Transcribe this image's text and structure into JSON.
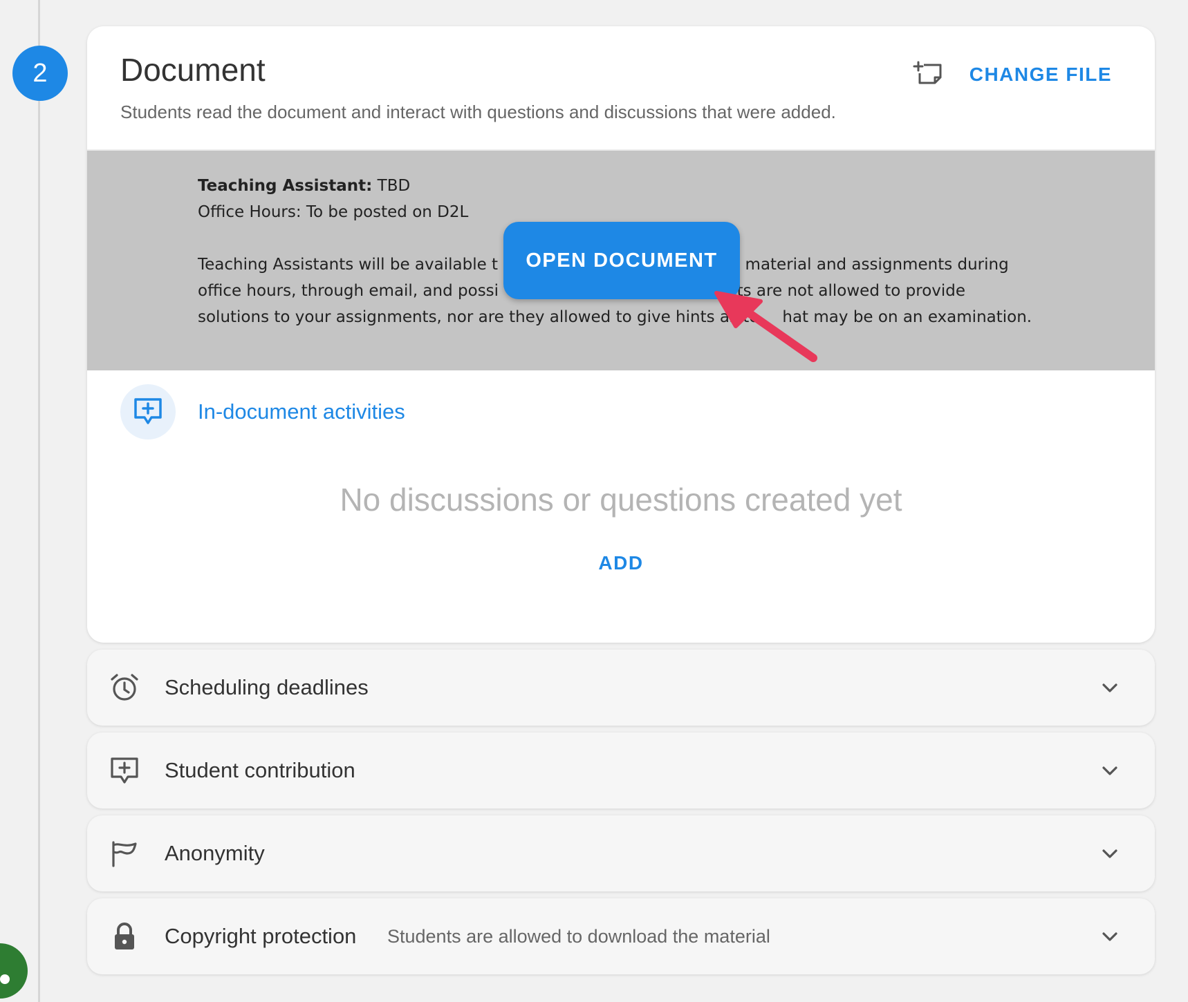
{
  "step": {
    "number": "2"
  },
  "card": {
    "title": "Document",
    "description": "Students read the document and interact with questions and discussions that were added.",
    "change_file_label": "CHANGE FILE",
    "open_document_label": "OPEN DOCUMENT",
    "preview": {
      "line1_bold": "Teaching Assistant:",
      "line1_rest": " TBD",
      "line2": "Office Hours: To be posted on D2L",
      "para1_a": "Teaching Assistants will be available t",
      "para1_b": "urse material and assignments during",
      "para2_a": "office hours, through email, and possi",
      "para2_b": "nts are not allowed to provide",
      "para3_a": "solutions to your assignments, nor are they allowed to give hints as to",
      "para3_b": "hat may be on an examination."
    },
    "activities_label": "In-document activities",
    "empty_message": "No discussions or questions created yet",
    "add_label": "ADD"
  },
  "sections": [
    {
      "label": "Scheduling deadlines",
      "icon": "alarm-icon"
    },
    {
      "label": "Student contribution",
      "icon": "add-comment-icon"
    },
    {
      "label": "Anonymity",
      "icon": "mask-icon"
    },
    {
      "label": "Copyright protection",
      "icon": "lock-icon",
      "subtitle": "Students are allowed to download the material"
    }
  ],
  "colors": {
    "accent": "#1e88e5",
    "arrow": "#e8385a",
    "preview_bg": "#c4c4c4"
  }
}
